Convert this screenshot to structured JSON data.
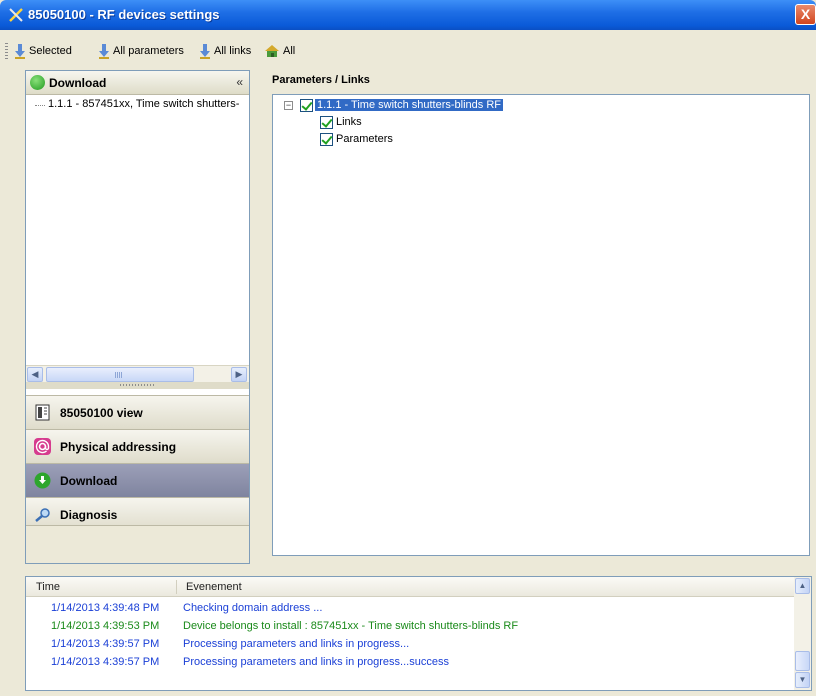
{
  "window": {
    "title": "85050100 - RF devices settings",
    "close_label": "X"
  },
  "toolbar": {
    "items": [
      {
        "label": "Selected",
        "icon": "download-arrow-icon"
      },
      {
        "label": "All parameters",
        "icon": "download-arrow-icon"
      },
      {
        "label": "All links",
        "icon": "download-arrow-icon"
      },
      {
        "label": "All",
        "icon": "house-icon"
      }
    ]
  },
  "left_panel": {
    "header": "Download",
    "collapse": "«",
    "tree_item": "1.1.1 - 857451xx, Time switch shutters-",
    "nav": [
      {
        "label": "85050100 view",
        "icon": "product-view-icon",
        "active": false
      },
      {
        "label": "Physical addressing",
        "icon": "at-sign-icon",
        "active": false
      },
      {
        "label": "Download",
        "icon": "download-icon",
        "active": true
      },
      {
        "label": "Diagnosis",
        "icon": "magnifier-icon",
        "active": false
      }
    ]
  },
  "right_panel": {
    "title": "Parameters / Links",
    "root": "1.1.1 - Time switch shutters-blinds RF",
    "children": [
      "Links",
      "Parameters"
    ],
    "expander": "−"
  },
  "log": {
    "columns": [
      "Time",
      "Evenement"
    ],
    "rows": [
      {
        "time": "1/14/2013 4:39:48 PM",
        "event": "Checking domain address ...",
        "color": "#1a3fd6"
      },
      {
        "time": "1/14/2013 4:39:53 PM",
        "event": "Device belongs to install : 857451xx - Time switch shutters-blinds RF",
        "color": "#1a8a1a"
      },
      {
        "time": "1/14/2013 4:39:57 PM",
        "event": "Processing parameters and links in progress...",
        "color": "#1a3fd6"
      },
      {
        "time": "1/14/2013 4:39:57 PM",
        "event": "Processing parameters and links in progress...success",
        "color": "#1a3fd6"
      }
    ]
  },
  "colors": {
    "accent": "#316ac5",
    "titlebar": "#0a5ad8",
    "active_nav": "#7f849f"
  }
}
